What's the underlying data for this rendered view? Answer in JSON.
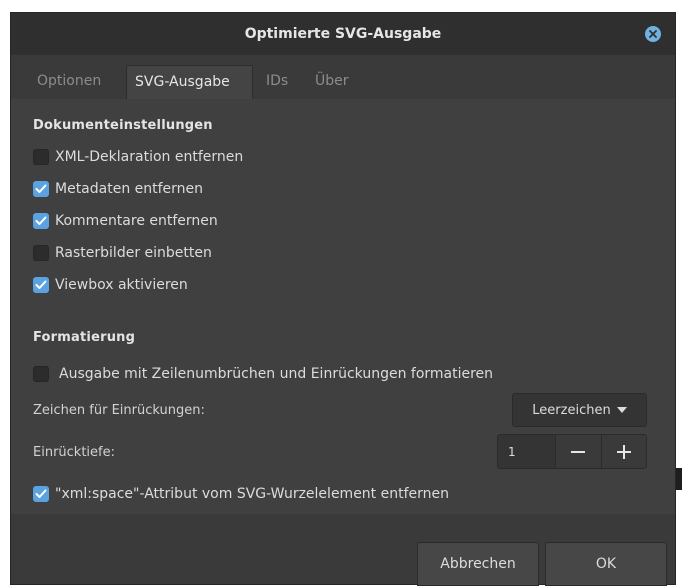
{
  "window": {
    "title": "Optimierte SVG-Ausgabe"
  },
  "tabs": [
    {
      "label": "Optionen",
      "active": false
    },
    {
      "label": "SVG-Ausgabe",
      "active": true
    },
    {
      "label": "IDs",
      "active": false
    },
    {
      "label": "Über",
      "active": false
    }
  ],
  "document_settings": {
    "title": "Dokumenteinstellungen",
    "options": [
      {
        "label": "XML-Deklaration entfernen",
        "checked": false
      },
      {
        "label": "Metadaten entfernen",
        "checked": true
      },
      {
        "label": "Kommentare entfernen",
        "checked": true
      },
      {
        "label": "Rasterbilder einbetten",
        "checked": false
      },
      {
        "label": "Viewbox aktivieren",
        "checked": true
      }
    ]
  },
  "formatting": {
    "title": "Formatierung",
    "pretty_print": {
      "label": "Ausgabe mit Zeilenumbrüchen und Einrückungen formatieren",
      "checked": false
    },
    "indent_char_label": "Zeichen für Einrückungen:",
    "indent_char_value": "Leerzeichen",
    "indent_depth_label": "Einrücktiefe:",
    "indent_depth_value": "1",
    "strip_xml_space": {
      "label": "\"xml:space\"-Attribut vom SVG-Wurzelelement entfernen",
      "checked": true
    }
  },
  "footer": {
    "cancel_label": "Abbrechen",
    "ok_label": "OK"
  },
  "colors": {
    "accent": "#5aa3e0",
    "close": "#6fb2e0",
    "background": "#404040"
  },
  "icons": {
    "close": "close-icon",
    "check": "check-icon",
    "minus": "minus-icon",
    "plus": "plus-icon",
    "caret": "chevron-down-icon"
  }
}
